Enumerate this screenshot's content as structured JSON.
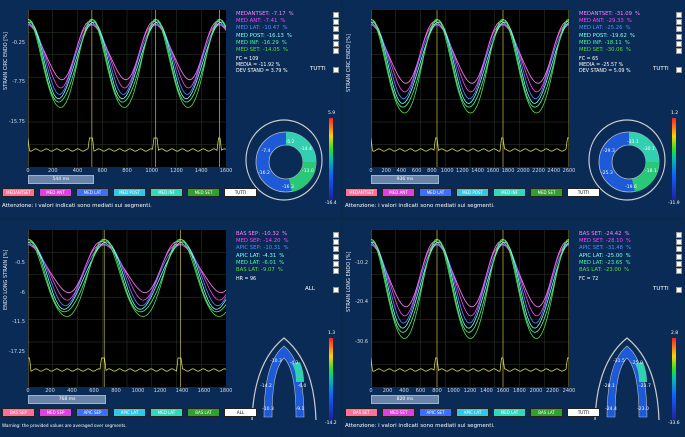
{
  "panels": [
    {
      "ylabel": "STRAIN CIRC ENDO [%]",
      "yticks": [
        "-0.25",
        "-7.75",
        "-15.75"
      ],
      "xticks": [
        "0",
        "200",
        "400",
        "600",
        "800",
        "1000",
        "1200",
        "1400",
        "1600"
      ],
      "ms_label": "544 ms",
      "legend": [
        {
          "label": "MEDANTSET:",
          "value": "-7.17",
          "unit": "%",
          "color": "#ff80ff"
        },
        {
          "label": "MED ANT:",
          "value": "-7.41",
          "unit": "%",
          "color": "#ff40ff"
        },
        {
          "label": "MED LAT:",
          "value": "-10.47",
          "unit": "%",
          "color": "#4f8dff"
        },
        {
          "label": "MED POST:",
          "value": "-16.13",
          "unit": "%",
          "color": "#7fffff"
        },
        {
          "label": "MED INF:",
          "value": "-16.29",
          "unit": "%",
          "color": "#40ffa0"
        },
        {
          "label": "MED SET:",
          "value": "-14.05",
          "unit": "%",
          "color": "#5cdc40"
        }
      ],
      "stats": [
        "FC = 109",
        "MEDIA = -11.92 %",
        "DEV STAND = 3.79 %"
      ],
      "all_label": "TUTTI",
      "colorbar": [
        "5.9",
        "-16.4"
      ],
      "seg_values": [
        "-5.2",
        "-7.4",
        "-16.2",
        "-16.3",
        "-13.0",
        "-14.4"
      ],
      "buttons": [
        {
          "label": "MEDANTSET",
          "color": "#ff6f9c"
        },
        {
          "label": "MED ANT",
          "color": "#e040e0"
        },
        {
          "label": "MED LAT",
          "color": "#3a6fff"
        },
        {
          "label": "MED POST",
          "color": "#30c8e8"
        },
        {
          "label": "MED INF",
          "color": "#30d8c0"
        },
        {
          "label": "MED SET",
          "color": "#30a030"
        },
        {
          "label": "TUTTI",
          "color": "#ffffff"
        }
      ],
      "note": "Attenzione: i valori indicati sono mediati sui segmenti."
    },
    {
      "ylabel": "STRAIN CIRC ENDO [%]",
      "yticks": [
        "",
        "",
        ""
      ],
      "xticks": [
        "0",
        "200",
        "400",
        "600",
        "800",
        "1000",
        "1200",
        "1400",
        "1600",
        "1800",
        "2000",
        "2200",
        "2400",
        "2600"
      ],
      "ms_label": "936 ms",
      "legend": [
        {
          "label": "MEDANTSET:",
          "value": "-31.09",
          "unit": "%",
          "color": "#ff80ff"
        },
        {
          "label": "MED ANT:",
          "value": "-29.33",
          "unit": "%",
          "color": "#ff40ff"
        },
        {
          "label": "MED LAT:",
          "value": "-25.26",
          "unit": "%",
          "color": "#4f8dff"
        },
        {
          "label": "MED POST:",
          "value": "-19.62",
          "unit": "%",
          "color": "#7fffff"
        },
        {
          "label": "MED INF:",
          "value": "-18.11",
          "unit": "%",
          "color": "#40ffa0"
        },
        {
          "label": "MED SET:",
          "value": "-30.06",
          "unit": "%",
          "color": "#5cdc40"
        }
      ],
      "stats": [
        "FC = 65",
        "MEDIA = -25.57 %",
        "DEV STAND = 5.09 %"
      ],
      "all_label": "TUTTI",
      "colorbar": [
        "1.2",
        "-31.9"
      ],
      "seg_values": [
        "-31.1",
        "-29.3",
        "-25.3",
        "-19.6",
        "-18.1",
        "-30.1"
      ],
      "buttons": [
        {
          "label": "MEDANTSET",
          "color": "#ff6f9c"
        },
        {
          "label": "MED ANT",
          "color": "#e040e0"
        },
        {
          "label": "MED LAT",
          "color": "#3a6fff"
        },
        {
          "label": "MED POST",
          "color": "#30c8e8"
        },
        {
          "label": "MED INF",
          "color": "#30d8c0"
        },
        {
          "label": "MED SET",
          "color": "#30a030"
        },
        {
          "label": "TUTTI",
          "color": "#ffffff"
        }
      ],
      "note": "Attenzione: i valori indicati sono mediati sui segmenti."
    },
    {
      "ylabel": "ENDO LONG STRAIN [%]",
      "yticks": [
        "-0.5",
        "-6",
        "-11.5",
        "-17.25"
      ],
      "xticks": [
        "0",
        "200",
        "400",
        "600",
        "800",
        "1000",
        "1200",
        "1400",
        "1600",
        "1800"
      ],
      "ms_label": "768 ms",
      "legend": [
        {
          "label": "BAS SEP:",
          "value": "-10.32",
          "unit": "%",
          "color": "#ff80ff"
        },
        {
          "label": "MED SEP:",
          "value": "-14.20",
          "unit": "%",
          "color": "#ff40ff"
        },
        {
          "label": "APIC SEP:",
          "value": "-10.31",
          "unit": "%",
          "color": "#4f8dff"
        },
        {
          "label": "APIC LAT:",
          "value": "-4.31",
          "unit": "%",
          "color": "#7fffff"
        },
        {
          "label": "MED LAT:",
          "value": "-6.01",
          "unit": "%",
          "color": "#40ffa0"
        },
        {
          "label": "BAS LAT:",
          "value": "-9.07",
          "unit": "%",
          "color": "#5cdc40"
        }
      ],
      "stats": [
        "HR = 96"
      ],
      "all_label": "ALL",
      "colorbar": [
        "1.3",
        "-14.2"
      ],
      "seg_values": [
        "-10.3",
        "-14.2",
        "-10.3",
        "-4.3",
        "-6.0",
        "-9.1"
      ],
      "buttons": [
        {
          "label": "BAS SEP",
          "color": "#ff6f9c"
        },
        {
          "label": "MED SEP",
          "color": "#e040e0"
        },
        {
          "label": "APIC SEP",
          "color": "#3a6fff"
        },
        {
          "label": "APIC LAT",
          "color": "#30c8e8"
        },
        {
          "label": "MED LAT",
          "color": "#30d8c0"
        },
        {
          "label": "BAS LAT",
          "color": "#30a030"
        },
        {
          "label": "ALL",
          "color": "#ffffff"
        }
      ],
      "note": "Warning: the provided values are averaged over segments."
    },
    {
      "ylabel": "STRAIN LONG ENDO [%]",
      "yticks": [
        "-10.2",
        "-20.4",
        "-30.6"
      ],
      "xticks": [
        "0",
        "200",
        "400",
        "600",
        "800",
        "1000",
        "1200",
        "1400",
        "1600",
        "1800",
        "2000",
        "2200",
        "2400"
      ],
      "ms_label": "820 ms",
      "legend": [
        {
          "label": "BAS SET:",
          "value": "-24.42",
          "unit": "%",
          "color": "#ff80ff"
        },
        {
          "label": "MED SET:",
          "value": "-28.10",
          "unit": "%",
          "color": "#ff40ff"
        },
        {
          "label": "APIC SET:",
          "value": "-31.48",
          "unit": "%",
          "color": "#4f8dff"
        },
        {
          "label": "APIC LAT:",
          "value": "-25.00",
          "unit": "%",
          "color": "#7fffff"
        },
        {
          "label": "MED LAT:",
          "value": "-23.65",
          "unit": "%",
          "color": "#40ffa0"
        },
        {
          "label": "BAS LAT:",
          "value": "-23.00",
          "unit": "%",
          "color": "#5cdc40"
        }
      ],
      "stats": [
        "FC = 72"
      ],
      "all_label": "TUTTI",
      "colorbar": [
        "2.8",
        "-33.6"
      ],
      "seg_values": [
        "-24.4",
        "-28.1",
        "-31.5",
        "-25.0",
        "-23.7",
        "-23.0"
      ],
      "buttons": [
        {
          "label": "BAS SET",
          "color": "#ff6f9c"
        },
        {
          "label": "MED SET",
          "color": "#e040e0"
        },
        {
          "label": "APIC SET",
          "color": "#3a6fff"
        },
        {
          "label": "APIC LAT",
          "color": "#30c8e8"
        },
        {
          "label": "MED LAT",
          "color": "#30d8c0"
        },
        {
          "label": "BAS LAT",
          "color": "#30a030"
        },
        {
          "label": "TUTTI",
          "color": "#ffffff"
        }
      ],
      "note": "Attenzione: i valori indicati sono mediati sui segmenti."
    }
  ]
}
